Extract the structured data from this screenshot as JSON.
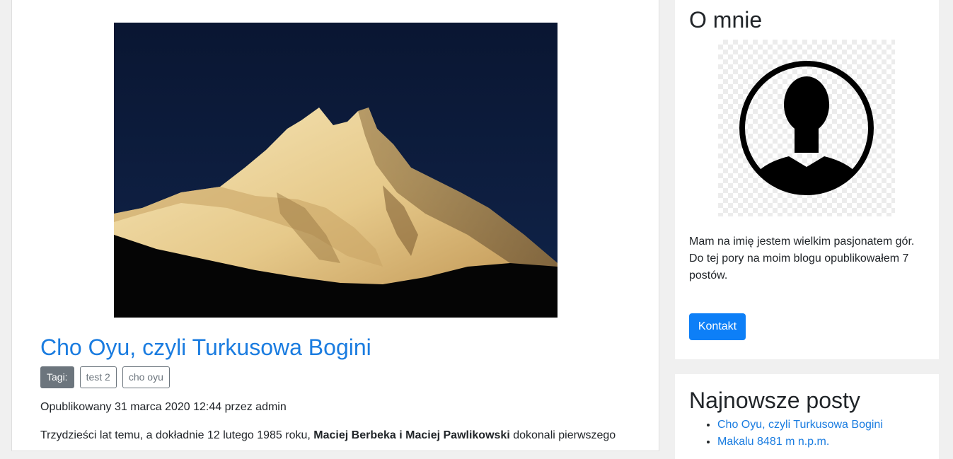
{
  "post": {
    "title": "Cho Oyu, czyli Turkusowa Bogini",
    "tags_label": "Tagi:",
    "tags": [
      "test 2",
      "cho oyu"
    ],
    "meta": "Opublikowany 31 marca 2020 12:44 przez admin",
    "excerpt_start": "Trzydzieści lat temu, a dokładnie 12 lutego 1985 roku, ",
    "excerpt_bold": "Maciej Berbeka i Maciej Pawlikowski",
    "excerpt_end": " dokonali pierwszego",
    "image_icon": "mountain-photo"
  },
  "sidebar": {
    "about": {
      "title": "O mnie",
      "avatar_icon": "user-silhouette-icon",
      "text": "Mam na imię jestem wielkim pasjonatem gór. Do tej pory na moim blogu opublikowałem 7 postów.",
      "button_label": "Kontakt"
    },
    "latest": {
      "title": "Najnowsze posty",
      "items": [
        "Cho Oyu, czyli Turkusowa Bogini",
        "Makalu 8481 m n.p.m."
      ]
    }
  },
  "colors": {
    "link": "#1a7ce0",
    "primary_button": "#0d7ff7",
    "tag_label_bg": "#6c757d",
    "page_bg": "#f0f0f0"
  }
}
